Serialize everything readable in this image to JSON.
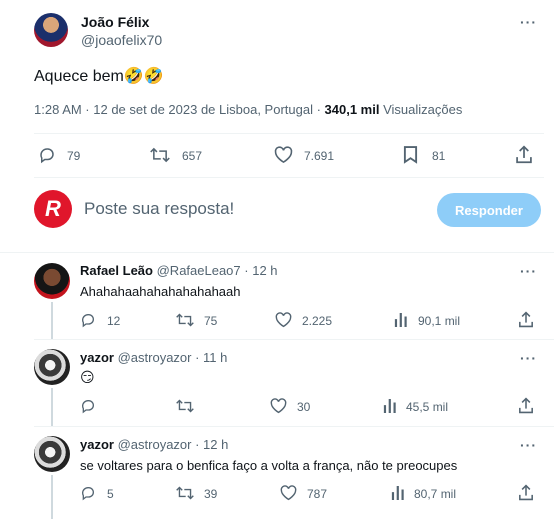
{
  "main_tweet": {
    "author_name": "João Félix",
    "author_handle": "@joaofelix70",
    "text": "Aquece bem",
    "emoji": "🤣🤣",
    "meta_time": "1:28 AM · 12 de set de 2023 de Lisboa, Portugal · ",
    "views_count": "340,1 mil",
    "views_label": " Visualizações",
    "stats": {
      "replies": "79",
      "retweets": "657",
      "likes": "7.691",
      "bookmarks": "81"
    },
    "more_label": "···"
  },
  "compose": {
    "placeholder": "Poste sua resposta!",
    "reply_button": "Responder",
    "avatar_letter": "R",
    "avatar_color": "#e0162b"
  },
  "replies": [
    {
      "author_name": "Rafael Leão",
      "author_handle": "@RafaeLeao7",
      "time": " · 12 h",
      "text": "Ahahahaahahahahahahaah",
      "stats": {
        "replies": "12",
        "retweets": "75",
        "likes": "2.225",
        "views": "90,1 mil"
      }
    },
    {
      "author_name": "yazor",
      "author_handle": "@astroyazor",
      "time": " · 11 h",
      "text": "😏",
      "stats": {
        "replies": "",
        "retweets": "",
        "likes": "30",
        "views": "45,5 mil"
      }
    },
    {
      "author_name": "yazor",
      "author_handle": "@astroyazor",
      "time": " · 12 h",
      "text": "se voltares para o benfica faço a volta a frança, não te preocupes",
      "stats": {
        "replies": "5",
        "retweets": "39",
        "likes": "787",
        "views": "80,7 mil"
      }
    }
  ],
  "colors": {
    "accent": "#1d9bf0",
    "text": "#0f1419",
    "muted": "#536471",
    "divider": "#eff3f4",
    "reply_button": "#8ecdf8"
  }
}
